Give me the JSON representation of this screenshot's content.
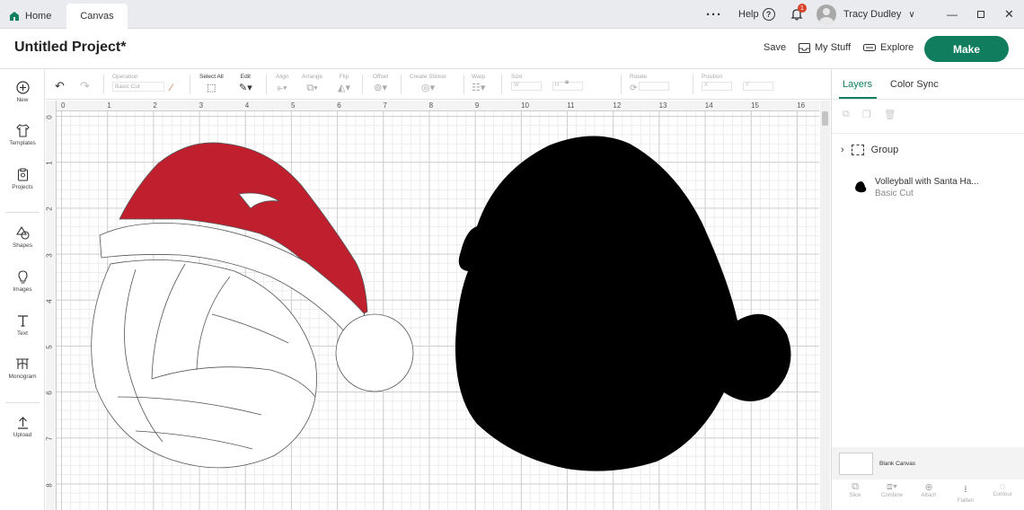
{
  "tabs": {
    "home": "Home",
    "canvas": "Canvas"
  },
  "topbar": {
    "help": "Help",
    "notifications": "1",
    "user": "Tracy Dudley"
  },
  "project": {
    "title": "Untitled Project*",
    "save": "Save",
    "my_stuff": "My Stuff",
    "explore": "Explore",
    "make": "Make"
  },
  "sidebar": {
    "items": [
      {
        "label": "New",
        "icon": "plus-circle-icon"
      },
      {
        "label": "Templates",
        "icon": "shirt-icon"
      },
      {
        "label": "Projects",
        "icon": "clipboard-icon"
      },
      {
        "label": "Shapes",
        "icon": "shapes-icon"
      },
      {
        "label": "Images",
        "icon": "bulb-icon"
      },
      {
        "label": "Text",
        "icon": "text-icon"
      },
      {
        "label": "Monogram",
        "icon": "monogram-icon"
      },
      {
        "label": "Upload",
        "icon": "upload-icon"
      }
    ]
  },
  "toolbar": {
    "operation": "Operation",
    "operation_value": "Basic Cut",
    "select_all": "Select All",
    "edit": "Edit",
    "align": "Align",
    "arrange": "Arrange",
    "flip": "Flip",
    "offset": "Offset",
    "create_sticker": "Create Sticker",
    "warp": "Warp",
    "size": "Size",
    "w": "W",
    "h": "H",
    "rotate": "Rotate",
    "position": "Position",
    "x": "X",
    "y": "Y"
  },
  "ruler": {
    "x": [
      "0",
      "1",
      "2",
      "3",
      "4",
      "5",
      "6",
      "7",
      "8",
      "9",
      "10",
      "11",
      "12",
      "13",
      "14",
      "15",
      "16"
    ],
    "y": [
      "0",
      "1",
      "2",
      "3",
      "4",
      "5",
      "6",
      "7",
      "8"
    ]
  },
  "panel": {
    "tab_layers": "Layers",
    "tab_color_sync": "Color Sync",
    "group_label": "Group",
    "layer_name": "Volleyball with Santa Ha...",
    "layer_op": "Basic Cut",
    "blank_canvas": "Blank Canvas",
    "footer": [
      "Slice",
      "Combine",
      "Attach",
      "Flatten",
      "Contour"
    ]
  },
  "colors": {
    "accent": "#0f7d5e",
    "hat_red": "#c0202e",
    "notification": "#d9422b"
  }
}
